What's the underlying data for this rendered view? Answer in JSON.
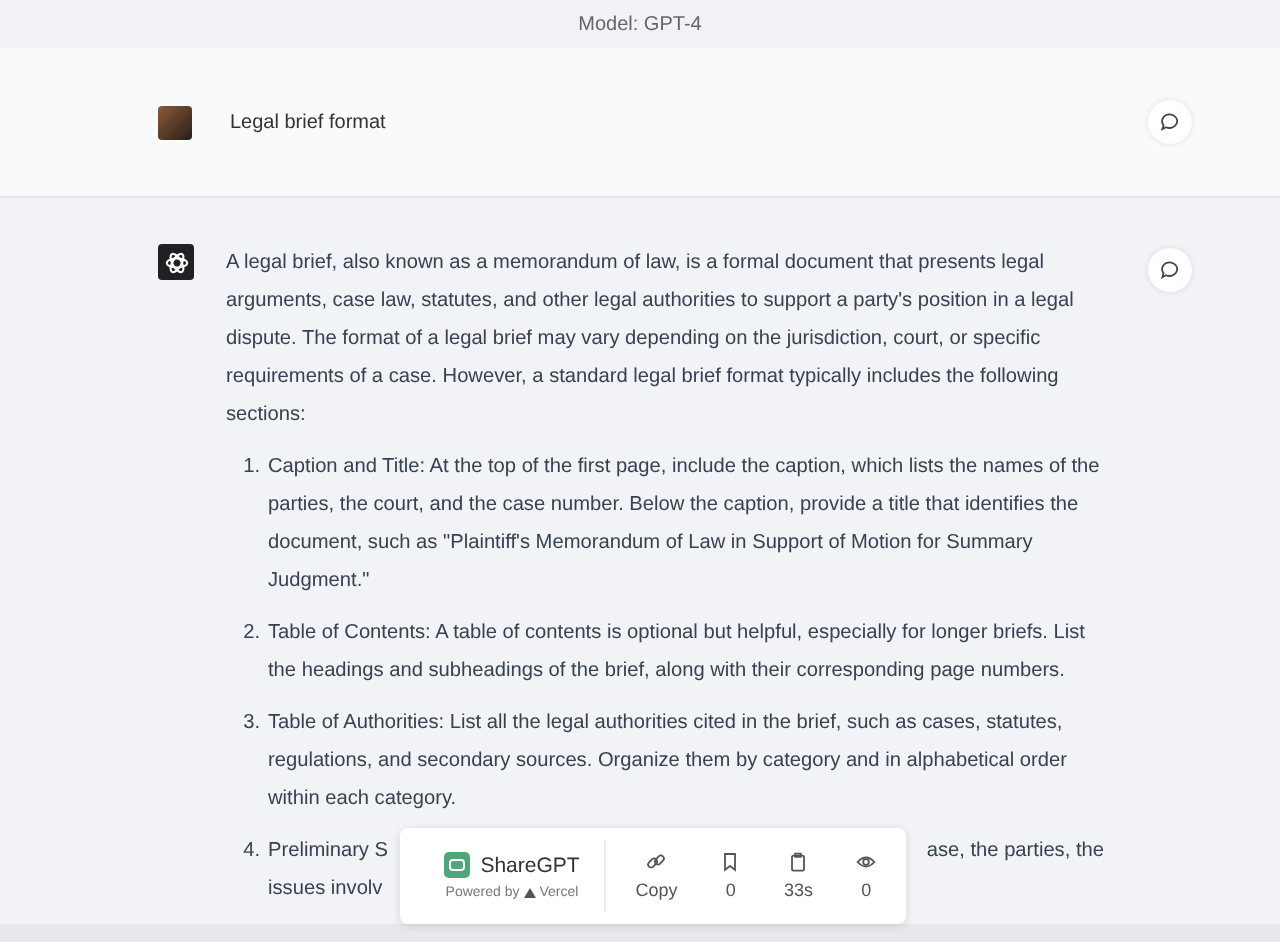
{
  "header": {
    "title": "Model: GPT-4"
  },
  "user_message": {
    "text": "Legal brief format"
  },
  "assistant_message": {
    "intro": "A legal brief, also known as a memorandum of law, is a formal document that presents legal arguments, case law, statutes, and other legal authorities to support a party's position in a legal dispute. The format of a legal brief may vary depending on the jurisdiction, court, or specific requirements of a case. However, a standard legal brief format typically includes the following sections:",
    "items": [
      {
        "number": "1.",
        "text": "Caption and Title: At the top of the first page, include the caption, which lists the names of the parties, the court, and the case number. Below the caption, provide a title that identifies the document, such as \"Plaintiff's Memorandum of Law in Support of Motion for Summary Judgment.\""
      },
      {
        "number": "2.",
        "text": "Table of Contents: A table of contents is optional but helpful, especially for longer briefs. List the headings and subheadings of the brief, along with their corresponding page numbers."
      },
      {
        "number": "3.",
        "text": "Table of Authorities: List all the legal authorities cited in the brief, such as cases, statutes, regulations, and secondary sources. Organize them by category and in alphabetical order within each category."
      }
    ],
    "partial_item": {
      "number": "4.",
      "line_start": "Preliminary S",
      "line_end": "ase, the parties, the",
      "second_line": "issues involv"
    }
  },
  "share_bar": {
    "brand": "ShareGPT",
    "powered_by": "Powered by",
    "vendor": "Vercel",
    "stats": [
      {
        "kind": "link",
        "label": "Copy"
      },
      {
        "kind": "bookmark",
        "label": "0"
      },
      {
        "kind": "clipboard",
        "label": "33s"
      },
      {
        "kind": "eye",
        "label": "0"
      }
    ]
  }
}
